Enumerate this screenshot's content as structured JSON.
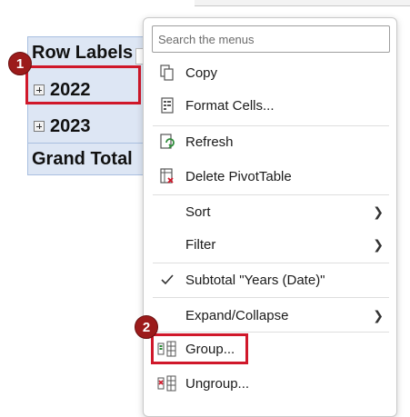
{
  "pivot": {
    "header": "Row Labels",
    "rows": [
      "2022",
      "2023"
    ],
    "grand_total": "Grand Total"
  },
  "badges": [
    "1",
    "2"
  ],
  "menu": {
    "search_placeholder": "Search the menus",
    "items": [
      {
        "label": "Copy",
        "icon": "copy-icon"
      },
      {
        "label": "Format Cells...",
        "icon": "format-cells-icon"
      },
      {
        "label": "Refresh",
        "icon": "refresh-icon"
      },
      {
        "label": "Delete PivotTable",
        "icon": "delete-pivottable-icon"
      },
      {
        "label": "Sort",
        "submenu": true
      },
      {
        "label": "Filter",
        "submenu": true
      },
      {
        "label": "Subtotal \"Years (Date)\"",
        "checked": true
      },
      {
        "label": "Expand/Collapse",
        "submenu": true
      },
      {
        "label": "Group...",
        "icon": "group-icon"
      },
      {
        "label": "Ungroup...",
        "icon": "ungroup-icon"
      }
    ]
  },
  "colors": {
    "highlight": "#d0182a",
    "badge": "#9c1b1b",
    "pivot_fill": "#dde6f4"
  }
}
